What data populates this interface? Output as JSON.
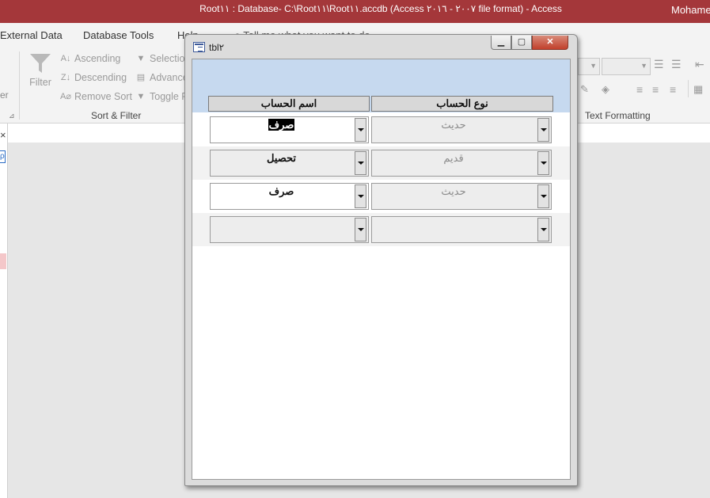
{
  "window_title": "Root١١ : Database- C:\\Root١١\\Root١١.accdb (Access ٢٠٠٧ - ٢٠١٦ file format)  -  Access",
  "user_name": "Mohame",
  "ribbon_tabs": [
    "External Data",
    "Database Tools",
    "Help"
  ],
  "tell_me": "Tell me what you want to do",
  "sort_filter": {
    "filter": "Filter",
    "ascending": "Ascending",
    "descending": "Descending",
    "remove_sort": "Remove Sort",
    "selection": "Selection",
    "advanced": "Advance",
    "toggle_filter": "Toggle F",
    "group_label": "Sort & Filter"
  },
  "left_group_fragment": "er",
  "text_formatting_label": "Text Formatting",
  "nav": {
    "close": "×",
    "search": "ρ"
  },
  "form": {
    "title": "tbl٢",
    "column_headers": {
      "type": "نوع الحساب",
      "name": "اسم الحساب"
    },
    "rows": [
      {
        "type": "حديث",
        "name": "صرف",
        "name_selected": true
      },
      {
        "type": "قديم",
        "name": "تحصيل"
      },
      {
        "type": "حديث",
        "name": "صرف"
      },
      {
        "type": "",
        "name": ""
      }
    ]
  }
}
